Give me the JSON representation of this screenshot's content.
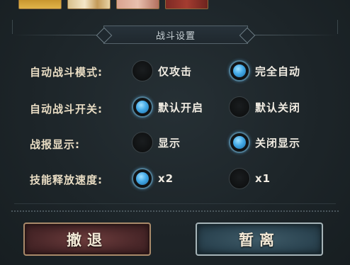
{
  "section_title": "战斗设置",
  "rows": [
    {
      "label": "自动战斗模式:",
      "options": [
        {
          "label": "仅攻击",
          "selected": false
        },
        {
          "label": "完全自动",
          "selected": true
        }
      ]
    },
    {
      "label": "自动战斗开关:",
      "options": [
        {
          "label": "默认开启",
          "selected": true
        },
        {
          "label": "默认关闭",
          "selected": false
        }
      ]
    },
    {
      "label": "战报显示:",
      "options": [
        {
          "label": "显示",
          "selected": false
        },
        {
          "label": "关闭显示",
          "selected": true
        }
      ]
    },
    {
      "label": "技能释放速度:",
      "options": [
        {
          "label": "x2",
          "selected": true
        },
        {
          "label": "x1",
          "selected": false
        }
      ]
    }
  ],
  "buttons": {
    "retreat_label": "撤退",
    "leave_label": "暂离"
  },
  "colors": {
    "selected_radio": "#43a9e6",
    "label_text": "#e8dcc3",
    "retreat_button": "#4a2729",
    "leave_button": "#2c4552"
  }
}
